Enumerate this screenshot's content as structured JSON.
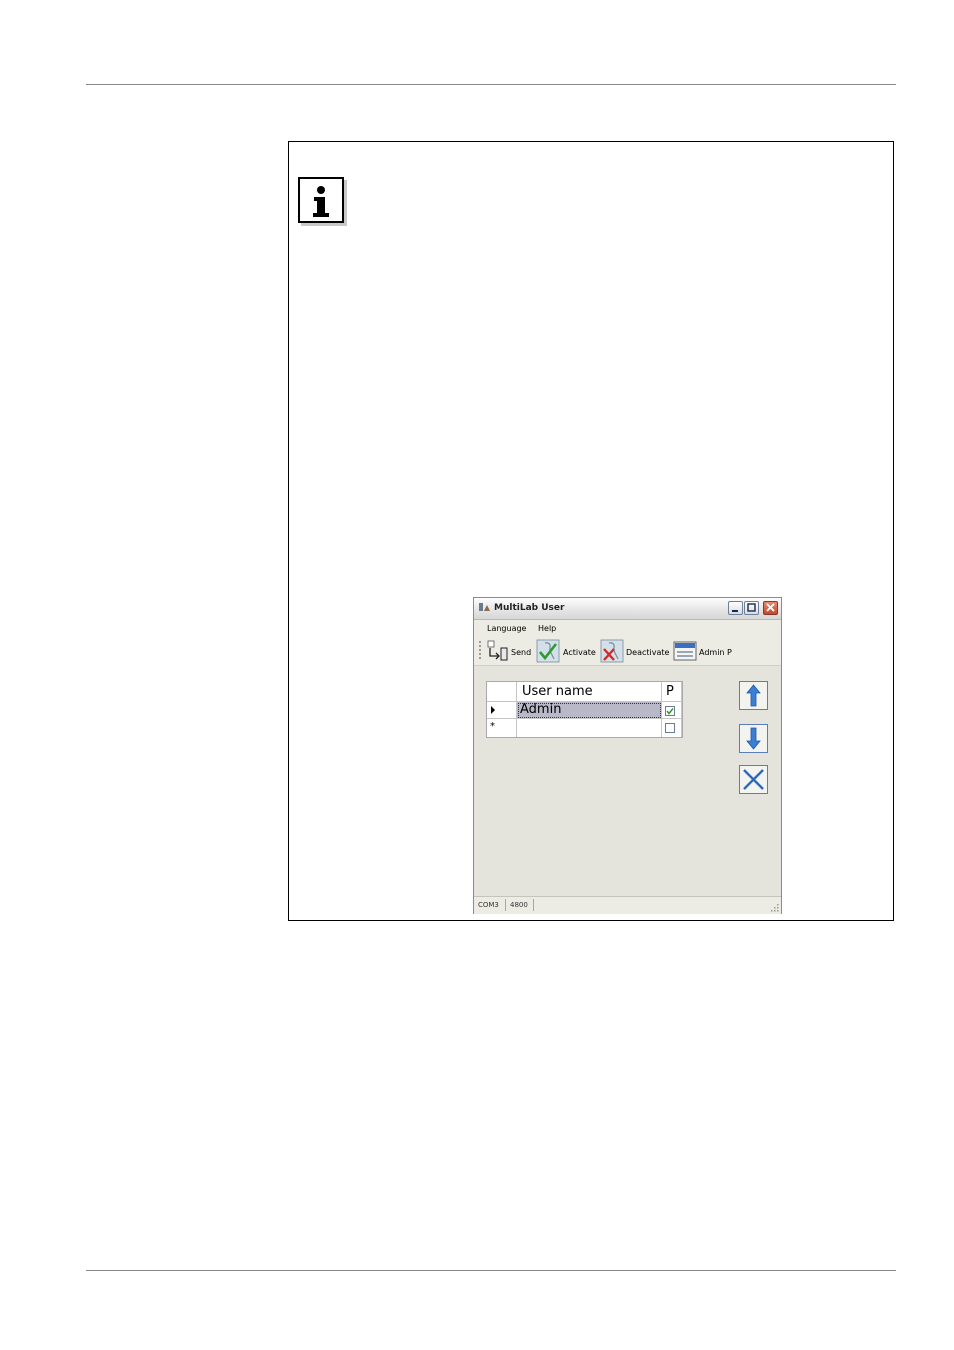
{
  "window": {
    "title": "MultiLab User",
    "menu": [
      "Language",
      "Help"
    ],
    "toolbar": {
      "send": "Send",
      "activate": "Activate",
      "deactivate": "Deactivate",
      "admin": "Admin P"
    },
    "grid": {
      "columns": [
        "User name",
        "P"
      ],
      "rows": [
        {
          "marker": "▸",
          "user": "Admin",
          "p_checked": true
        },
        {
          "marker": "*",
          "user": "",
          "p_checked": false
        }
      ]
    },
    "status": [
      "COM3",
      "4800"
    ]
  },
  "icons": {
    "info": "info-icon",
    "up": "arrow-up-icon",
    "down": "arrow-down-icon",
    "delete": "delete-x-icon"
  },
  "colors": {
    "accent_blue": "#3a7fd5",
    "check_green": "#2f9a2f",
    "close_red": "#c24a2d"
  }
}
